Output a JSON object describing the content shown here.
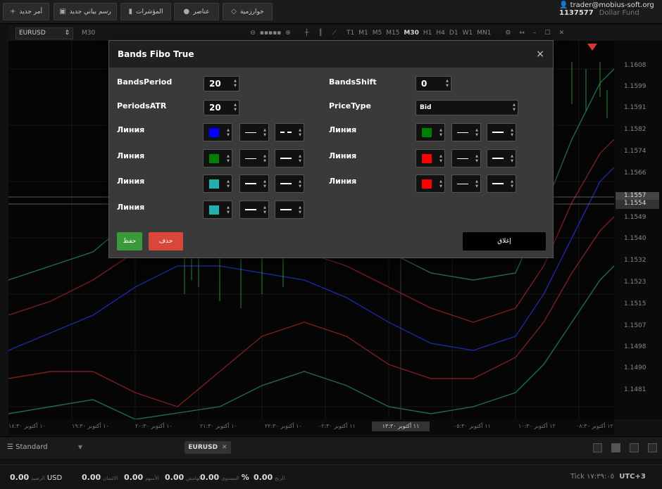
{
  "toolbar": {
    "new_order": "أمر جديد",
    "new_chart": "رسم بياني جديد",
    "indicators": "المؤشرات",
    "elements": "عناصر",
    "algorithm": "خوارزمية"
  },
  "account": {
    "email": "trader@mobius-soft.org",
    "number": "1137577",
    "fund": "Dollar Fund"
  },
  "chart": {
    "symbol": "EURUSD",
    "period": "M30",
    "timeframes": [
      "T1",
      "M1",
      "M5",
      "M15",
      "M30",
      "H1",
      "H4",
      "D1",
      "W1",
      "MN1"
    ],
    "price_labels": [
      "1.1608",
      "1.1599",
      "1.1591",
      "1.1582",
      "1.1574",
      "1.1566",
      "1.1549",
      "1.1540",
      "1.1532",
      "1.1523",
      "1.1515",
      "1.1507",
      "1.1498",
      "1.1490",
      "1.1481"
    ],
    "price_box_1": "1.1557",
    "price_box_2": "1.1554",
    "time_labels": [
      "١٠ أكتوبر ١٨:٣٠",
      "١٠ أكتوبر ١٩:٣٠",
      "١٠ أكتوبر ٢٠:٣٠",
      "١٠ أكتوبر ٢١:٣٠",
      "١٠ أكتوبر ٢٢:٣٠",
      "١١ أكتوبر ٠٢:٣٠",
      "١١ أكتوبر ٠٥:٣٠",
      "١١ أكتوبر ٠٨:٣٠",
      "١١ أكتوبر ١١:٣٠",
      "١٢ أكتوبر ١٠:٣٠",
      "١٢ أكتوبر ٠٩:٣٠",
      "١٢ أكتوبر ٠٨:٣٠"
    ],
    "time_selected": "١١ أكتوبر ١٣:٣٠"
  },
  "bottom": {
    "workspace": "Standard",
    "tab": "EURUSD",
    "balance": "0.00",
    "balance_label": "الرصيد",
    "currency": "USD",
    "credit": "0.00",
    "credit_label": "الائتمان",
    "equity": "0.00",
    "equity_label": "الأسهم",
    "margin": "0.00",
    "margin_label": "الهامش",
    "free_margin": "0.00",
    "free_margin_label": "المستوى",
    "pct": "%",
    "profit": "0.00",
    "profit_label": "الربح",
    "tick_label": "Tick",
    "tick_time": "١٧:٣٩:٠٥",
    "utc": "UTC+3"
  },
  "dialog": {
    "title": "Bands Fibo True",
    "close_icon": "×",
    "left": {
      "bands_period_label": "BandsPeriod",
      "bands_period": "20",
      "periods_atr_label": "PeriodsATR",
      "periods_atr": "20",
      "lines": [
        {
          "label": "Линия",
          "color": "#0000ff",
          "style1": "solid",
          "style2": "dash"
        },
        {
          "label": "Линия",
          "color": "#008000",
          "style1": "solid",
          "style2": "thick"
        },
        {
          "label": "Линия",
          "color": "#20b2aa",
          "style1": "thick",
          "style2": "thick"
        },
        {
          "label": "Линия",
          "color": "#20b2aa",
          "style1": "thick",
          "style2": "thick"
        }
      ]
    },
    "right": {
      "bands_shift_label": "BandsShift",
      "bands_shift": "0",
      "price_type_label": "PriceType",
      "price_type": "Bid",
      "lines": [
        {
          "label": "Линия",
          "color": "#008000",
          "style1": "solid",
          "style2": "thick"
        },
        {
          "label": "Линия",
          "color": "#ff0000",
          "style1": "solid",
          "style2": "thick"
        },
        {
          "label": "Линия",
          "color": "#ff0000",
          "style1": "solid",
          "style2": "thick"
        }
      ]
    },
    "save_label": "حفظ",
    "delete_label": "حذف",
    "close_label": "إغلاق"
  }
}
